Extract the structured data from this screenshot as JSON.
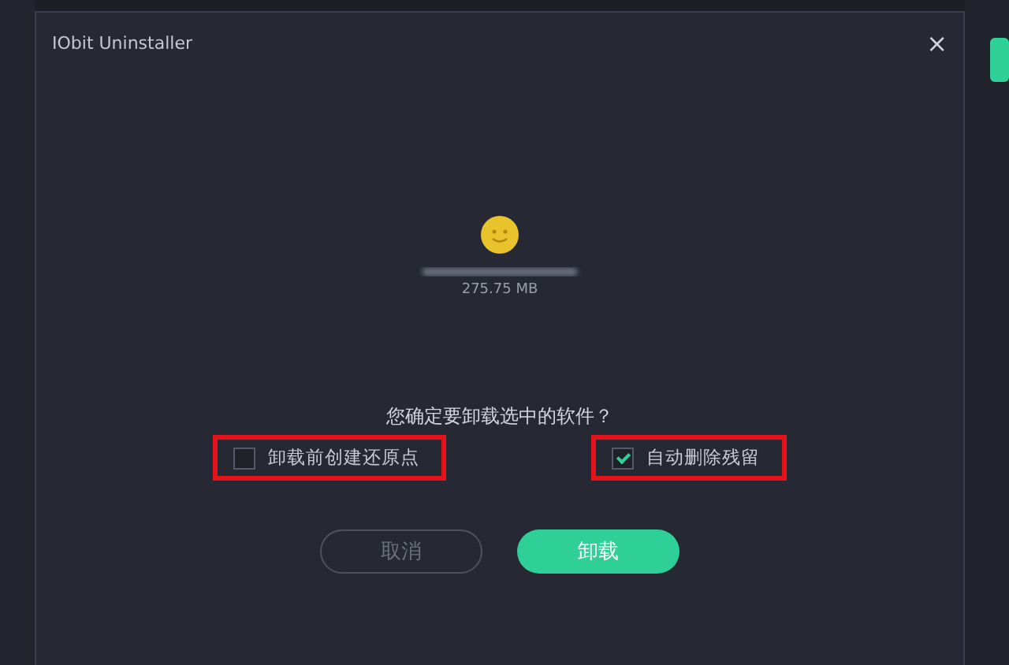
{
  "dialog": {
    "title": "IObit Uninstaller",
    "close": "×"
  },
  "program": {
    "size": "275.75 MB"
  },
  "question": "您确定要卸载选中的软件？",
  "options": [
    {
      "label": "卸载前创建还原点",
      "checked": false
    },
    {
      "label": "自动删除残留",
      "checked": true
    }
  ],
  "buttons": [
    {
      "label": "取消",
      "kind": "secondary"
    },
    {
      "label": "卸载",
      "kind": "primary"
    }
  ]
}
